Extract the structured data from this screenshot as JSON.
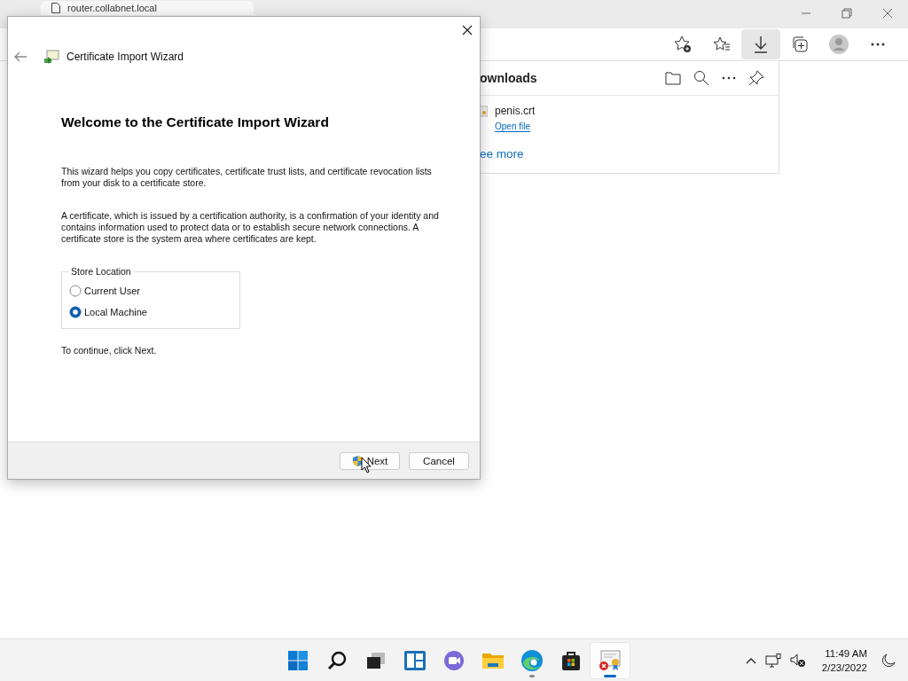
{
  "browser": {
    "tab_title": "router.collabnet.local"
  },
  "downloads": {
    "title": "ownloads",
    "items": [
      {
        "name": "penis.crt",
        "action": "Open file"
      }
    ],
    "see_more": "ee more"
  },
  "dialog": {
    "title": "Certificate Import Wizard",
    "heading": "Welcome to the Certificate Import Wizard",
    "paragraphs": [
      "This wizard helps you copy certificates, certificate trust lists, and certificate revocation lists from your disk to a certificate store.",
      "A certificate, which is issued by a certification authority, is a confirmation of your identity and contains information used to protect data or to establish secure network connections. A certificate store is the system area where certificates are kept."
    ],
    "group": {
      "label": "Store Location",
      "options": [
        {
          "label": "Current User",
          "selected": false
        },
        {
          "label": "Local Machine",
          "selected": true
        }
      ]
    },
    "footer_text": "To continue, click Next.",
    "buttons": [
      {
        "label": "Next",
        "kind": "shield"
      },
      {
        "label": "Cancel",
        "kind": "plain"
      }
    ]
  },
  "taskbar": {
    "apps": [
      {
        "kind": "start",
        "running": false,
        "selected": false
      },
      {
        "kind": "search",
        "running": false,
        "selected": false
      },
      {
        "kind": "taskview",
        "running": false,
        "selected": false
      },
      {
        "kind": "widgets",
        "running": false,
        "selected": false
      },
      {
        "kind": "chat",
        "running": false,
        "selected": false
      },
      {
        "kind": "explorer",
        "running": false,
        "selected": false
      },
      {
        "kind": "edge",
        "running": true,
        "selected": false
      },
      {
        "kind": "store",
        "running": false,
        "selected": false
      },
      {
        "kind": "certificate",
        "running": true,
        "selected": true
      }
    ],
    "time": "11:49 AM",
    "date": "2/23/2022"
  }
}
